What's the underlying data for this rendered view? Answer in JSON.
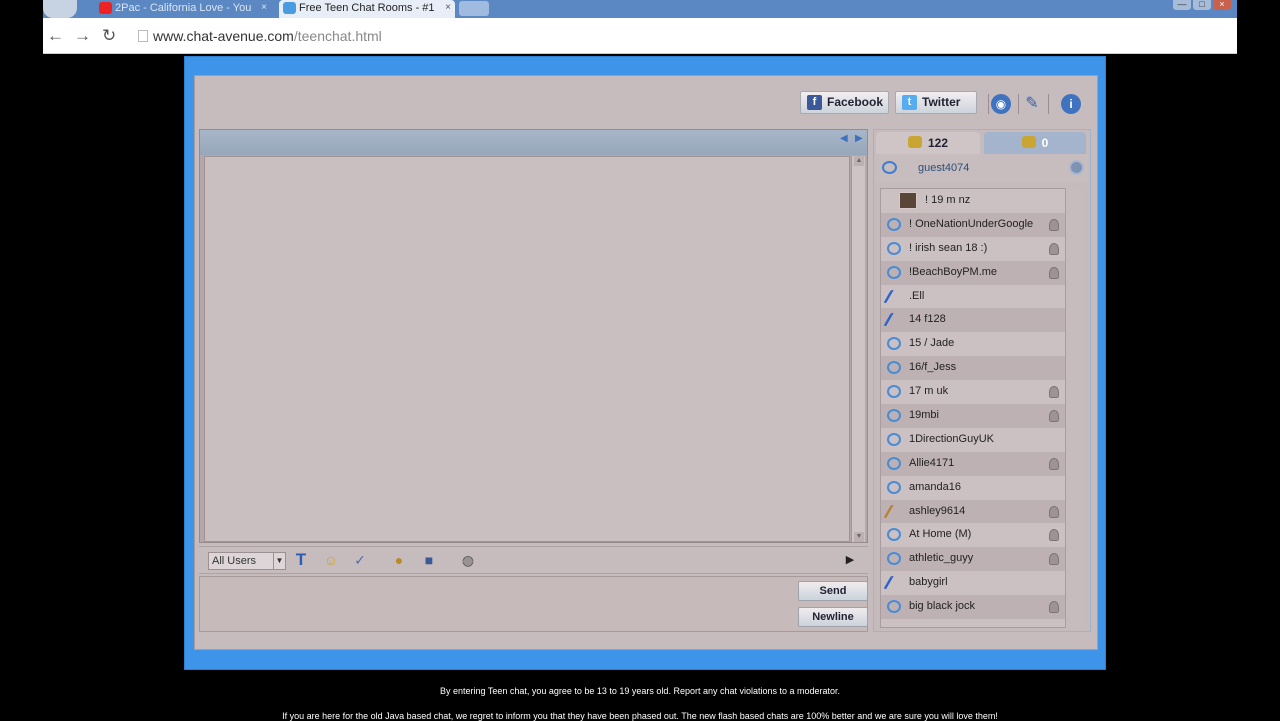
{
  "browser": {
    "tabs": [
      {
        "label": "2Pac - California Love - You",
        "close": "×",
        "icon_color": "#e22"
      },
      {
        "label": "Free Teen Chat Rooms - #1",
        "close": "×",
        "icon_color": "#4a9be0"
      }
    ],
    "nav": {
      "back": "←",
      "forward": "→",
      "reload": "↻"
    },
    "url": {
      "host": "www.chat-avenue.com",
      "path": "/teenchat.html"
    },
    "window_controls": [
      "—",
      "□",
      "×"
    ]
  },
  "chat": {
    "social": {
      "facebook": "Facebook",
      "twitter": "Twitter"
    },
    "header_arrows": {
      "left": "◀",
      "right": "▶"
    },
    "tabs": {
      "users_count": "122",
      "friends_count": "0"
    },
    "self_name": "guest4074",
    "users": [
      {
        "name": "!   19 m nz",
        "icon": "photo",
        "pin": false
      },
      {
        "name": "!   OneNationUnderGoogle",
        "icon": "chat",
        "pin": true
      },
      {
        "name": "! irish sean 18 :)",
        "icon": "chat",
        "pin": true
      },
      {
        "name": "!BeachBoyPM.me",
        "icon": "chat",
        "pin": true
      },
      {
        "name": ".Ell",
        "icon": "feather",
        "pin": false
      },
      {
        "name": "14 f128",
        "icon": "feather",
        "pin": false
      },
      {
        "name": "15 / Jade",
        "icon": "chat",
        "pin": false
      },
      {
        "name": "16/f_Jess",
        "icon": "chat",
        "pin": false
      },
      {
        "name": "17 m uk",
        "icon": "chat",
        "pin": true
      },
      {
        "name": "19mbi",
        "icon": "chat",
        "pin": true
      },
      {
        "name": "1DirectionGuyUK",
        "icon": "chat",
        "pin": false
      },
      {
        "name": "Allie4171",
        "icon": "chat",
        "pin": true
      },
      {
        "name": "amanda16",
        "icon": "chat",
        "pin": false
      },
      {
        "name": "ashley9614",
        "icon": "feather-orange",
        "pin": true
      },
      {
        "name": "At Home (M)",
        "icon": "chat",
        "pin": true
      },
      {
        "name": "athletic_guyy",
        "icon": "chat",
        "pin": true
      },
      {
        "name": "babygirl",
        "icon": "feather",
        "pin": false
      },
      {
        "name": "big black jock",
        "icon": "chat",
        "pin": true
      }
    ],
    "input": {
      "recipient": "All Users",
      "send": "Send",
      "newline": "Newline",
      "expand_arrow": "▶"
    }
  },
  "footer": {
    "line1": "By entering Teen chat, you agree to be 13 to 19 years old. Report any chat violations to a moderator.",
    "line2": "If you are here for the old Java based chat, we regret to inform you that they have been phased out. The new flash based chats are 100% better and we are sure you will love them!"
  }
}
